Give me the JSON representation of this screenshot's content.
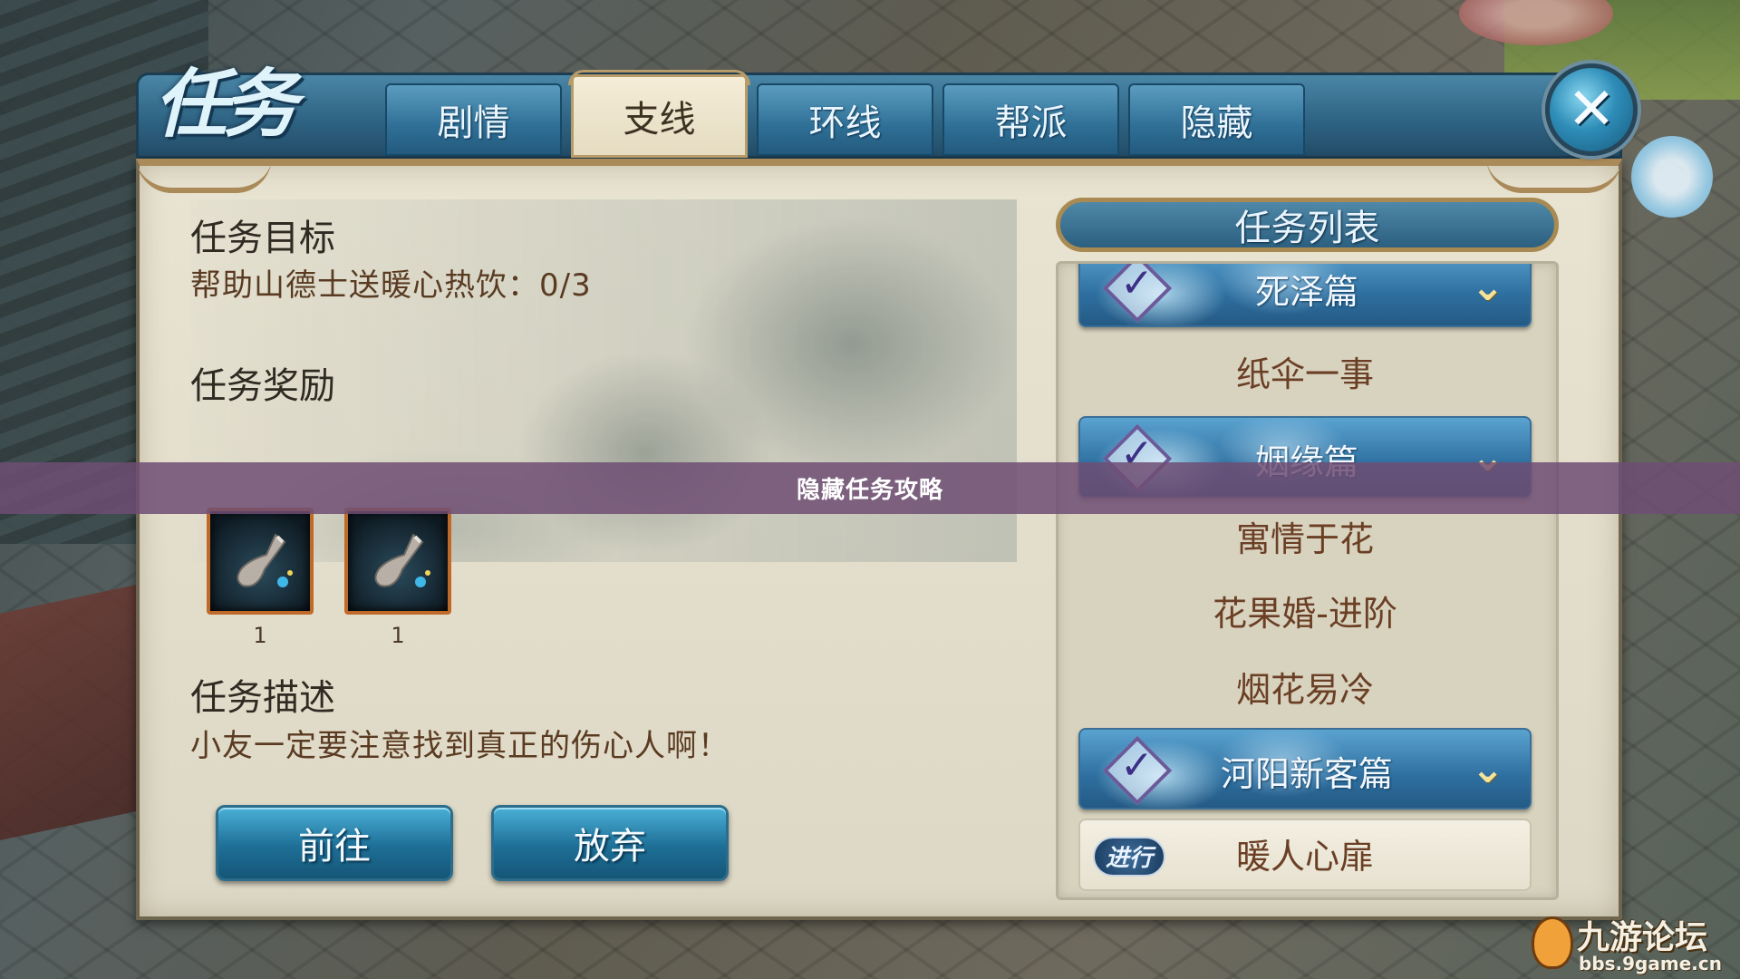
{
  "window": {
    "title": "任务",
    "close_label": "✕"
  },
  "tabs": [
    {
      "label": "剧情",
      "active": false
    },
    {
      "label": "支线",
      "active": true
    },
    {
      "label": "环线",
      "active": false
    },
    {
      "label": "帮派",
      "active": false
    },
    {
      "label": "隐藏",
      "active": false
    }
  ],
  "detail": {
    "objective_title": "任务目标",
    "objective_text": "帮助山德士送暖心热饮：0/3",
    "reward_title": "任务奖励",
    "rewards": [
      {
        "icon": "potion-icon",
        "count": "1"
      },
      {
        "icon": "potion-icon",
        "count": "1"
      }
    ],
    "description_title": "任务描述",
    "description_text": "小友一定要注意找到真正的伤心人啊！"
  },
  "actions": {
    "go_label": "前往",
    "abandon_label": "放弃"
  },
  "quest_list": {
    "header": "任务列表",
    "entries": [
      {
        "type": "group",
        "label": "死泽篇"
      },
      {
        "type": "item",
        "label": "纸伞一事"
      },
      {
        "type": "group",
        "label": "姻缘篇"
      },
      {
        "type": "item",
        "label": "寓情于花"
      },
      {
        "type": "item",
        "label": "花果婚-进阶"
      },
      {
        "type": "item",
        "label": "烟花易冷"
      },
      {
        "type": "group",
        "label": "河阳新客篇"
      },
      {
        "type": "item",
        "label": "暖人心扉",
        "status": "进行"
      }
    ]
  },
  "banner": {
    "text": "隐藏任务攻略"
  },
  "watermark": {
    "title": "九游论坛",
    "url": "bbs.9game.cn"
  },
  "colors": {
    "tab_blue": "#2f6f96",
    "tab_active": "#f4ecd6",
    "banner": "#6e4e73",
    "reward_border": "#c06a2a",
    "item_text": "#6b3f25"
  }
}
